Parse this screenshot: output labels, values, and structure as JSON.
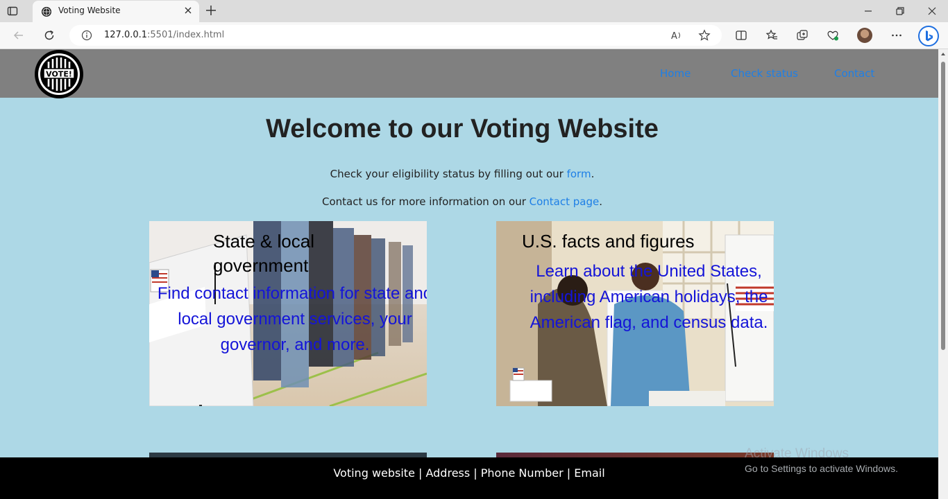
{
  "browser": {
    "tab_title": "Voting Website",
    "url_host": "127.0.0.1",
    "url_rest": ":5501/index.html"
  },
  "site": {
    "logo_text": "VOTE!",
    "nav": [
      {
        "label": "Home"
      },
      {
        "label": "Check status"
      },
      {
        "label": "Contact"
      }
    ],
    "heading": "Welcome to our Voting Website",
    "line1_prefix": "Check your eligibility status by filling out our ",
    "line1_link": "form",
    "line1_suffix": ".",
    "line2_prefix": "Contact us for more information on our ",
    "line2_link": "Contact page",
    "line2_suffix": ".",
    "cards": [
      {
        "title": "State & local government",
        "text": "Find contact information for state and local government services, your governor, and more."
      },
      {
        "title": "U.S. facts and figures",
        "text": "Learn about the United States, including American holidays, the American flag, and census data."
      }
    ],
    "footer": "Voting website | Address | Phone Number | Email"
  },
  "os": {
    "activate_title": "Activate Windows",
    "activate_sub": "Go to Settings to activate Windows."
  },
  "colors": {
    "page_bg": "#add8e6",
    "header_bg": "#808080",
    "link": "#1e7fe6",
    "card_text": "#1414d8",
    "footer_bg": "#000000"
  }
}
